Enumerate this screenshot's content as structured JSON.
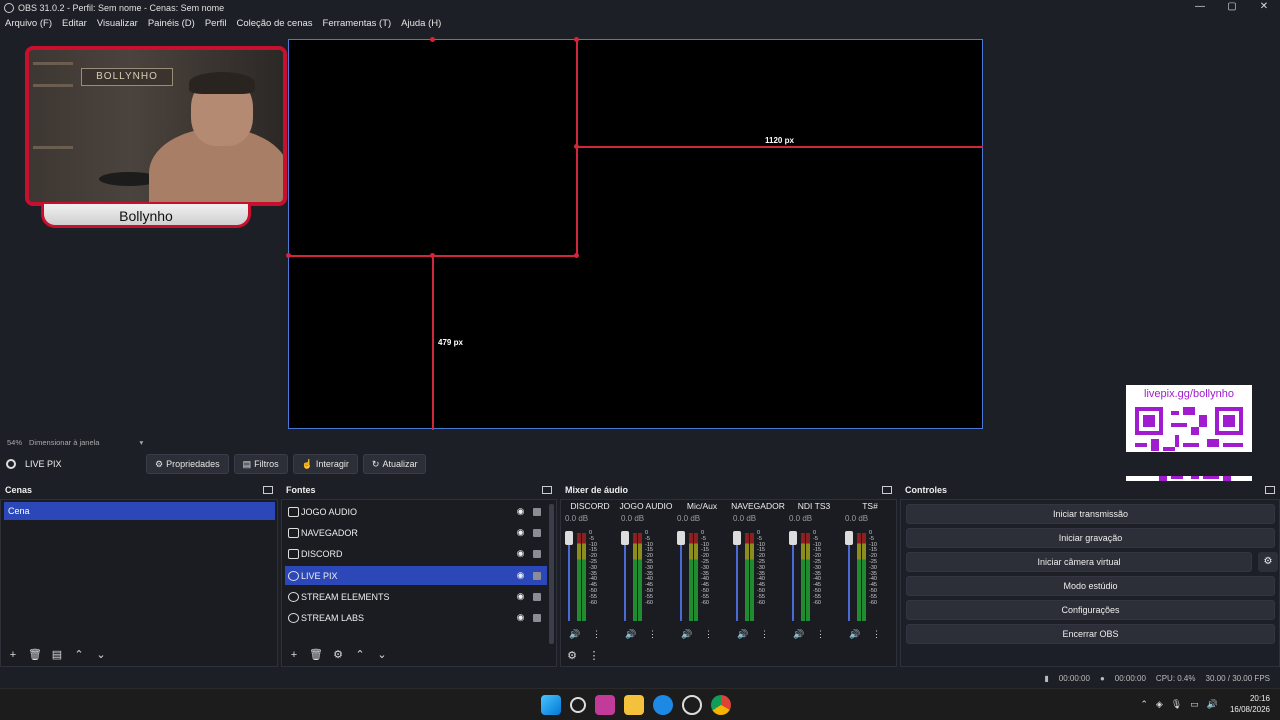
{
  "window": {
    "title": "OBS 31.0.2 - Perfil: Sem nome - Cenas: Sem nome",
    "controls": [
      "—",
      "▢",
      "✕"
    ]
  },
  "menu": [
    "Arquivo (F)",
    "Editar",
    "Visualizar",
    "Painéis (D)",
    "Perfil",
    "Coleção de cenas",
    "Ferramentas (T)",
    "Ajuda (H)"
  ],
  "preview": {
    "measure_h": "1120 px",
    "measure_v": "479 px",
    "cam_brand": "BOLLYNHO",
    "cam_name": "Bollynho",
    "qr_text": "livepix.gg/bollynho"
  },
  "status_row": {
    "zoom": "54%",
    "scale_mode": "Dimensionar à janela"
  },
  "source_toolbar": {
    "selected_source": "LIVE PIX",
    "buttons": [
      "Propriedades",
      "Filtros",
      "Interagir",
      "Atualizar"
    ]
  },
  "scenes": {
    "title": "Cenas",
    "items": [
      "Cena"
    ]
  },
  "sources": {
    "title": "Fontes",
    "items": [
      {
        "name": "JOGO AUDIO",
        "type": "window"
      },
      {
        "name": "NAVEGADOR",
        "type": "window"
      },
      {
        "name": "DISCORD",
        "type": "window"
      },
      {
        "name": "LIVE PIX",
        "type": "browser",
        "selected": true
      },
      {
        "name": "STREAM ELEMENTS",
        "type": "browser"
      },
      {
        "name": "STREAM LABS",
        "type": "browser"
      }
    ]
  },
  "mixer": {
    "title": "Mixer de áudio",
    "channels": [
      {
        "name": "DISCORD",
        "db": "0.0 dB"
      },
      {
        "name": "JOGO AUDIO",
        "db": "0.0 dB"
      },
      {
        "name": "Mic/Aux",
        "db": "0.0 dB"
      },
      {
        "name": "NAVEGADOR",
        "db": "0.0 dB"
      },
      {
        "name": "NDI TS3",
        "db": "0.0 dB"
      },
      {
        "name": "TS#",
        "db": "0.0 dB"
      }
    ],
    "scale": [
      "0",
      "-5",
      "-10",
      "-15",
      "-20",
      "-25",
      "-30",
      "-35",
      "-40",
      "-45",
      "-50",
      "-55",
      "-60"
    ]
  },
  "controls": {
    "title": "Controles",
    "buttons": [
      "Iniciar transmissão",
      "Iniciar gravação",
      "Iniciar câmera virtual",
      "Modo estúdio",
      "Configurações",
      "Encerrar OBS"
    ]
  },
  "bottom_status": {
    "stream_time": "00:00:00",
    "rec_time": "00:00:00",
    "cpu": "CPU: 0.4%",
    "fps": "30.00 / 30.00 FPS"
  },
  "clock": {
    "time": "20:16",
    "date": "16/08/2026"
  },
  "colors": {
    "accent": "#2c48b8",
    "guide": "#d2263a",
    "qr": "#a21ccf"
  }
}
